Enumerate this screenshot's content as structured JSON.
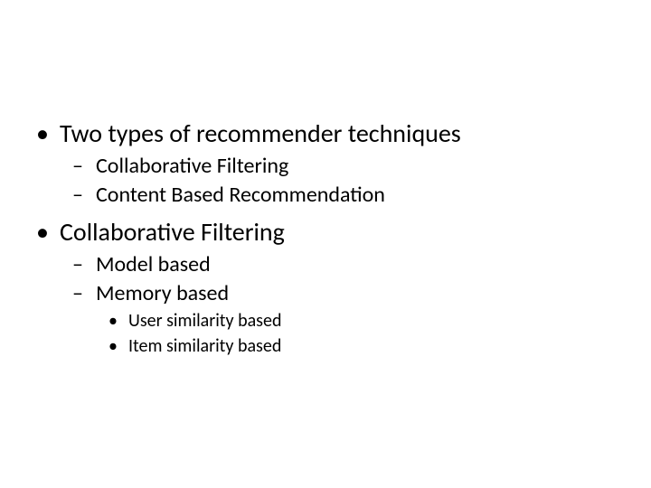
{
  "bullets": {
    "disc": "•",
    "dash": "–"
  },
  "outline": {
    "item1": {
      "label": "Two types of recommender techniques",
      "sub1": "Collaborative Filtering",
      "sub2": "Content Based Recommendation"
    },
    "item2": {
      "label": "Collaborative Filtering",
      "sub1": "Model based",
      "sub2": {
        "label": "Memory based",
        "sub1": "User similarity based",
        "sub2": "Item similarity based"
      }
    }
  }
}
